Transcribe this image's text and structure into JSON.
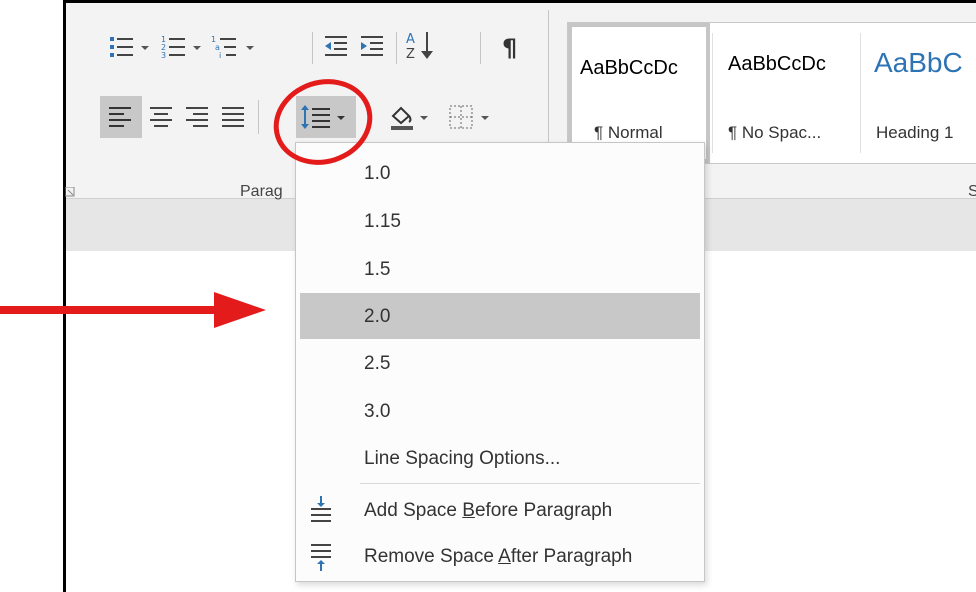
{
  "ribbon": {
    "paragraph_group_label": "Parag",
    "styles_group_label": "S"
  },
  "styles": [
    {
      "sample": "AaBbCcDc",
      "name": "¶ Normal",
      "selected": true
    },
    {
      "sample": "AaBbCcDc",
      "name": "¶ No Spac...",
      "selected": false
    },
    {
      "sample": "AaBbC",
      "name": "Heading 1",
      "selected": false
    }
  ],
  "line_spacing_menu": {
    "items": [
      {
        "label": "1.0"
      },
      {
        "label": "1.15"
      },
      {
        "label": "1.5"
      },
      {
        "label": "2.0",
        "highlighted": true
      },
      {
        "label": "2.5"
      },
      {
        "label": "3.0"
      }
    ],
    "options_label": "Line Spacing Options...",
    "add_before": {
      "pre": "Add Space ",
      "accel": "B",
      "post": "efore Paragraph"
    },
    "remove_after": {
      "pre": "Remove Space ",
      "accel": "A",
      "post": "fter Paragraph"
    }
  },
  "colors": {
    "annotation_red": "#e31b1b",
    "highlight": "#c8c8c8",
    "accent_blue": "#2e74b5"
  }
}
